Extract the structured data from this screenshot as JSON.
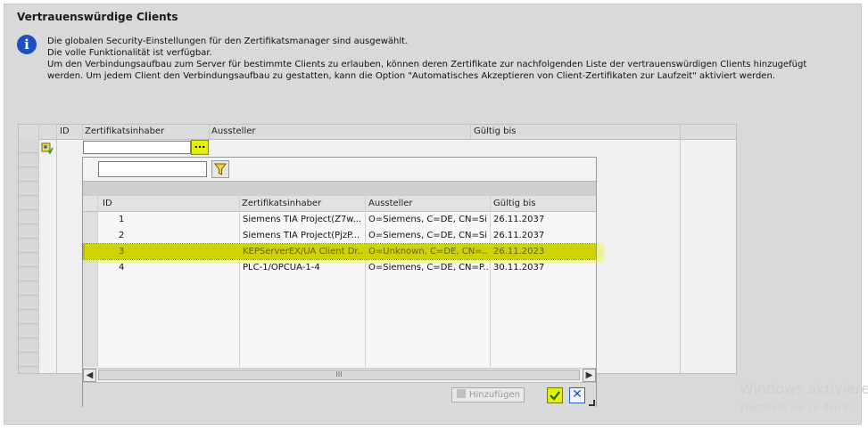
{
  "panel": {
    "title": "Vertrauenswürdige Clients",
    "info_lines": [
      "Die globalen Security-Einstellungen für den Zertifikatsmanager sind ausgewählt.",
      "Die volle Funktionalität ist verfügbar.",
      "Um den Verbindungsaufbau zum Server für bestimmte Clients zu erlauben, können deren Zertifikate zur nachfolgenden Liste der vertrauenswürdigen Clients hinzugefügt",
      "werden. Um jedem Client den Verbindungsaufbau zu gestatten, kann die Option \"Automatisches Akzeptieren von Client-Zertifikaten zur Laufzeit\" aktiviert werden."
    ]
  },
  "grid": {
    "columns": [
      "ID",
      "Zertifikatsinhaber",
      "Aussteller",
      "Gültig bis"
    ],
    "edit_button_label": "..."
  },
  "dropdown": {
    "filter_value": "",
    "columns": [
      "ID",
      "Zertifikatsinhaber",
      "Aussteller",
      "Gültig bis"
    ],
    "rows": [
      {
        "id": "1",
        "holder": "Siemens TIA Project(Z7w...",
        "issuer": "O=Siemens, C=DE, CN=Si...",
        "valid": "26.11.2037"
      },
      {
        "id": "2",
        "holder": "Siemens TIA Project(PjzP...",
        "issuer": "O=Siemens, C=DE, CN=Si...",
        "valid": "26.11.2037"
      },
      {
        "id": "3",
        "holder": "KEPServerEX/UA Client Dr...",
        "issuer": "O=Unknown, C=DE, CN=...",
        "valid": "26.11.2023"
      },
      {
        "id": "4",
        "holder": "PLC-1/OPCUA-1-4",
        "issuer": "O=Siemens, C=DE, CN=P...",
        "valid": "30.11.2037"
      }
    ],
    "selected_index": 2,
    "scroll_thumb_label": "III",
    "add_button_label": "Hinzufügen"
  },
  "watermark": {
    "line1": "Windows aktiviere",
    "line2": "Wechseln Sie zu den Ei"
  },
  "colors": {
    "accent_yellow": "#e4f000",
    "selection": "#bfc200",
    "info_blue": "#1b4fc4"
  },
  "icons": [
    "info-icon",
    "certificate-icon",
    "filter-icon",
    "checkmark-icon",
    "close-icon",
    "scroll-left-icon",
    "scroll-right-icon"
  ]
}
